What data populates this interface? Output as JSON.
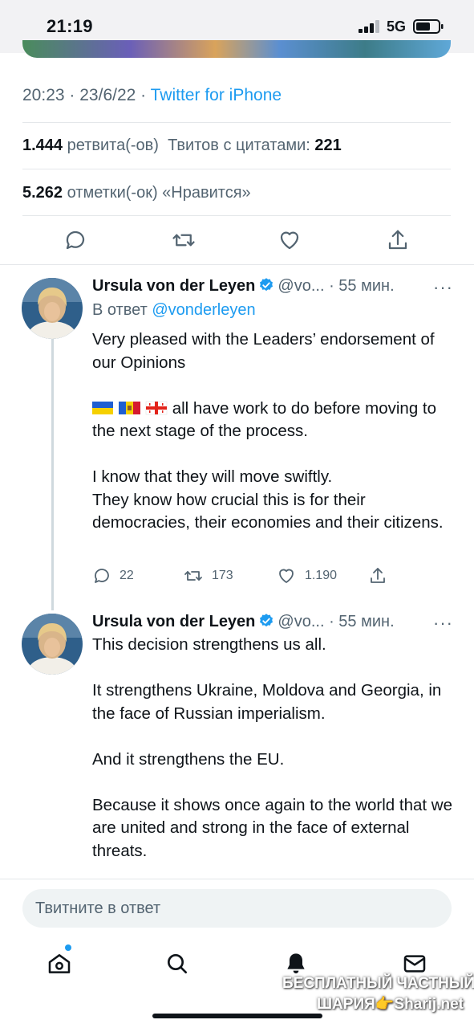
{
  "status_bar": {
    "time": "21:19",
    "network": "5G"
  },
  "tweet": {
    "time": "20:23",
    "date": "23/6/22",
    "separator": "·",
    "source": "Twitter for iPhone",
    "retweets_count": "1.444",
    "retweets_label": "ретвита(-ов)",
    "quotes_label": "Твитов с цитатами:",
    "quotes_count": "221",
    "likes_count": "5.262",
    "likes_label": "отметки(-ок) «Нравится»"
  },
  "replies": [
    {
      "name": "Ursula von der Leyen",
      "handle": "@vo...",
      "time": "· 55 мин.",
      "more": "···",
      "reply_to_label": "В ответ",
      "reply_to_handle": "@vonderleyen",
      "lines": [
        "Very pleased with the Leaders’ endorsement of our Opinions",
        "all have work to do before moving to the next stage of the process.",
        "I know that they will move swiftly.",
        "They know how crucial this is for their democracies, their economies and their citizens."
      ],
      "reply_count": "22",
      "retweet_count": "173",
      "like_count": "1.190"
    },
    {
      "name": "Ursula von der Leyen",
      "handle": "@vo...",
      "time": "· 55 мин.",
      "more": "···",
      "lines": [
        "This decision strengthens us all.",
        "It strengthens Ukraine, Moldova and Georgia, in the face of Russian imperialism.",
        "And it strengthens the EU.",
        "Because it shows once again to the world that we are united and strong in the face of external threats."
      ]
    }
  ],
  "compose": {
    "placeholder": "Твитните в ответ"
  },
  "watermark": {
    "line1": "БЕСПЛАТНЫЙ ЧАСТНЫЙ",
    "line2": "ШАРИЯ👉Sharij.net"
  },
  "icons": {
    "reply": "comment-icon",
    "retweet": "retweet-icon",
    "like": "heart-icon",
    "share": "share-icon",
    "home": "home-icon",
    "search": "search-icon",
    "notifications": "bell-icon",
    "messages": "mail-icon"
  },
  "colors": {
    "accent": "#1d9bf0",
    "text": "#0f1419",
    "muted": "#536471",
    "border": "#e4e7ea"
  }
}
